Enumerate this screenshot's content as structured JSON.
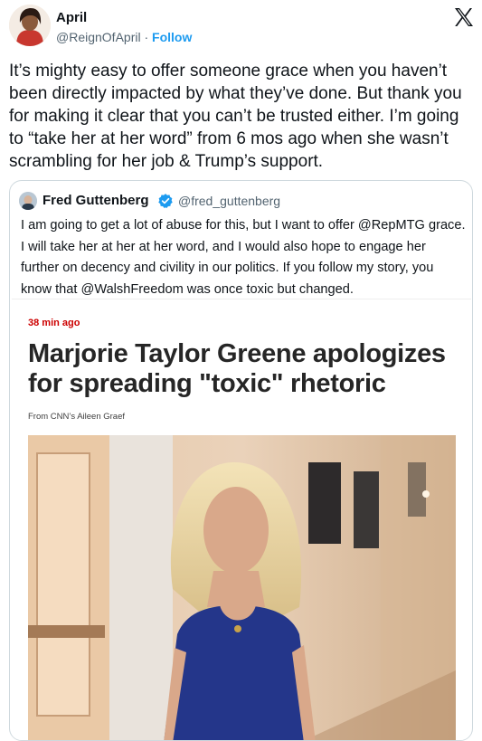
{
  "tweet": {
    "author_name": "April",
    "author_handle": "@ReignOfApril",
    "separator": " · ",
    "follow_label": "Follow",
    "text": "It’s mighty easy to offer someone grace when you haven’t been directly impacted by what they’ve done. But thank you for making it clear that you can’t be trusted either. I’m going to “take her at her word” from 6 mos ago when she wasn’t scrambling for her job & Trump’s support."
  },
  "quoted_tweet": {
    "author_name": "Fred Guttenberg",
    "author_handle": "@fred_guttenberg",
    "text": "I am going to get a lot of abuse for this, but I want to offer @RepMTG grace.  I will take her at her at her word, and I would also hope to engage her further on decency and civility in our politics.  If you follow my story, you know that @WalshFreedom was once toxic but changed."
  },
  "article_card": {
    "timestamp": "38 min ago",
    "headline": "Marjorie Taylor Greene apologizes for spreading \"toxic\" rhetoric",
    "byline": "From CNN’s Aileen Graef"
  },
  "colors": {
    "link_blue": "#1d9bf0",
    "secondary_text": "#536471",
    "border": "#cfd9de",
    "timestamp_red": "#cc0000",
    "verified_blue": "#1d9bf0"
  },
  "icons": {
    "platform_logo": "x-logo-icon",
    "verified_badge": "verified-badge-icon"
  }
}
